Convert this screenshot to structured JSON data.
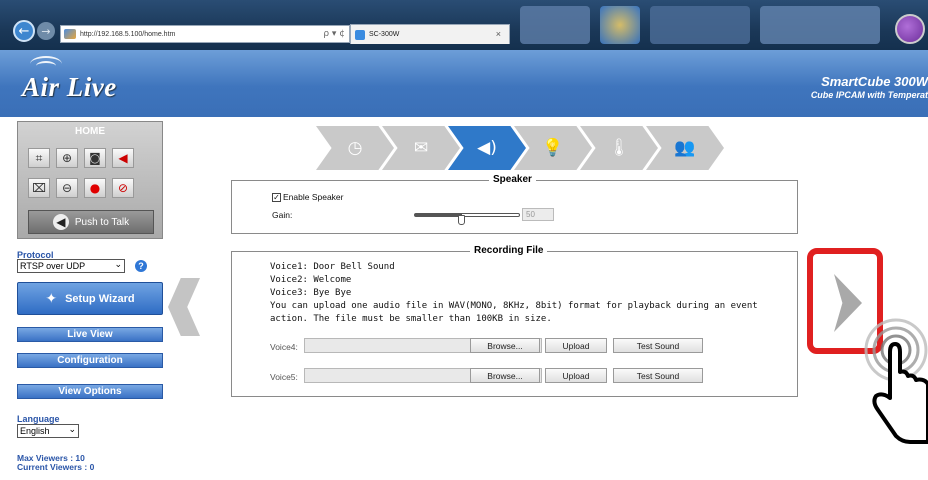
{
  "browser": {
    "url": "http://192.168.5.100/home.htm",
    "address_tools": "ρ ▾ ¢",
    "tab_title": "SC-300W",
    "tab_close": "×"
  },
  "header": {
    "logo_text": "Air Live",
    "product_title": "SmartCube 300W",
    "product_subtitle": "Cube IPCAM with Temperat"
  },
  "sidebar": {
    "home_label": "HOME",
    "push_to_talk_label": "Push to Talk",
    "protocol_label": "Protocol",
    "protocol_value": "RTSP over UDP",
    "setup_wizard_label": "Setup Wizard",
    "live_view_label": "Live View",
    "configuration_label": "Configuration",
    "view_options_label": "View Options",
    "language_label": "Language",
    "language_value": "English",
    "max_viewers": "Max Viewers : 10",
    "current_viewers": "Current Viewers : 0"
  },
  "steps": [
    {
      "icon": "clock-icon",
      "glyph": "◷",
      "active": false
    },
    {
      "icon": "mail-icon",
      "glyph": "✉",
      "active": false
    },
    {
      "icon": "speaker-icon",
      "glyph": "◀)",
      "active": true
    },
    {
      "icon": "lightbulb-icon",
      "glyph": "💡",
      "active": false
    },
    {
      "icon": "thermometer-icon",
      "glyph": "🌡",
      "active": false
    },
    {
      "icon": "people-icon",
      "glyph": "👥",
      "active": false
    }
  ],
  "speaker": {
    "legend": "Speaker",
    "enable_label": "Enable Speaker",
    "enabled": true,
    "gain_label": "Gain:",
    "gain_value": "50",
    "gain_level": 0.44
  },
  "recording": {
    "legend": "Recording File",
    "lines": [
      "Voice1: Door Bell Sound",
      "Voice2: Welcome",
      "Voice3: Bye Bye",
      "You can upload one audio file in WAV(MONO, 8KHz, 8bit) format for playback during an event",
      "action. The file must be smaller than 100KB in size."
    ],
    "voices": [
      {
        "label": "Voice4:",
        "browse": "Browse...",
        "upload": "Upload",
        "test": "Test Sound"
      },
      {
        "label": "Voice5:",
        "browse": "Browse...",
        "upload": "Upload",
        "test": "Test Sound"
      }
    ]
  },
  "colors": {
    "accent": "#2f79c9",
    "highlight": "#e02020",
    "banner": "#3f75bd"
  }
}
